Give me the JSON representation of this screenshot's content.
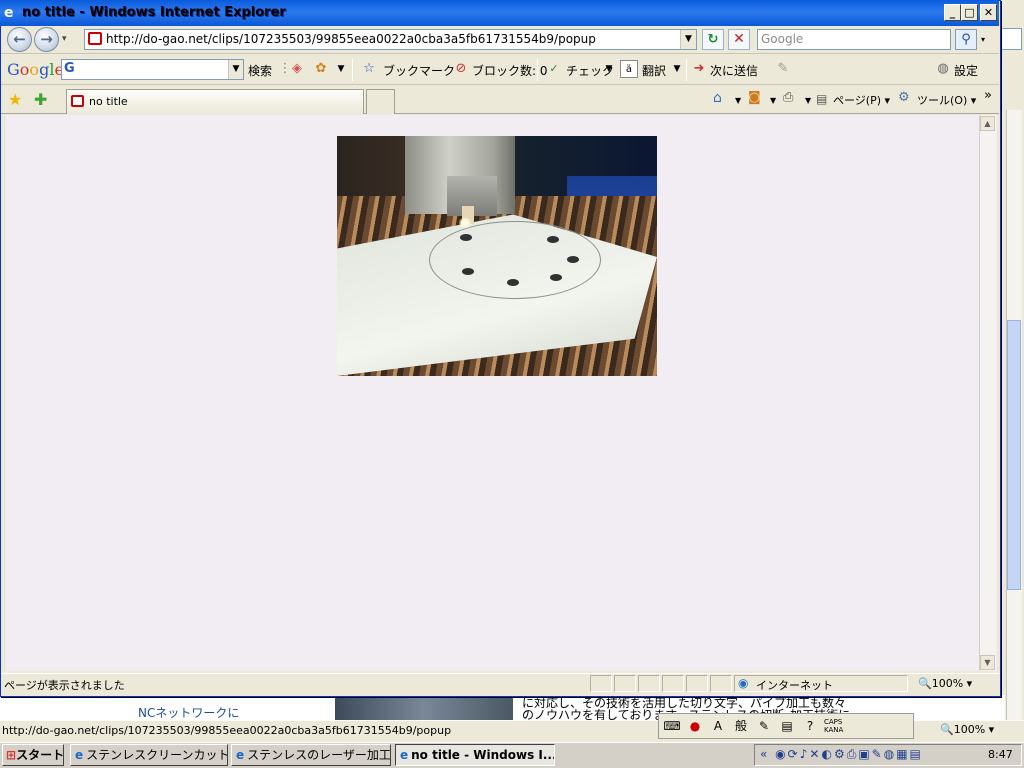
{
  "background_window": {
    "link_text": "NCネットワークに",
    "body_text_line1": "に対応し、その技術を活用した切り文字、パイプ加工も数々",
    "body_text_line2": "のノウハウを有しております。ステンレスの切断･加工技術に",
    "status_url": "http://do-gao.net/clips/107235503/99855eea0022a0cba3a5fb61731554b9/popup",
    "zoom": "100%"
  },
  "window": {
    "title": "no title - Windows Internet Explorer",
    "title_icon": "ie-logo-icon"
  },
  "address_bar": {
    "url": "http://do-gao.net/clips/107235503/99855eea0022a0cba3a5fb61731554b9/popup",
    "search_placeholder": "Google"
  },
  "google_toolbar": {
    "logo": {
      "g": "G",
      "o1": "o",
      "o2": "o",
      "g2": "g",
      "l": "l",
      "e": "e"
    },
    "search_prefix": "G",
    "search_label": "検索",
    "bookmark_label": "ブックマーク",
    "blocked_label": "ブロック数: 0",
    "check_label": "チェック",
    "translate_label": "翻訳",
    "send_label": "次に送信",
    "settings_label": "設定"
  },
  "tabs": {
    "active_tab_label": "no title"
  },
  "command_bar": {
    "page_label": "ページ(P)",
    "tools_label": "ツール(O)",
    "more": "»"
  },
  "status_bar": {
    "text": "ページが表示されました",
    "zone": "インターネット",
    "zoom": "100%"
  },
  "taskbar": {
    "start_label": "スタート",
    "tasks": [
      {
        "label": "ステンレスクリーンカットのレ..."
      },
      {
        "label": "ステンレスのレーザー加工、..."
      },
      {
        "label": "no title - Windows I..."
      }
    ],
    "clock": "8:47"
  },
  "ime": {
    "mode_a": "A",
    "mode_label": "般",
    "caps": "CAPS",
    "kana": "KANA"
  }
}
